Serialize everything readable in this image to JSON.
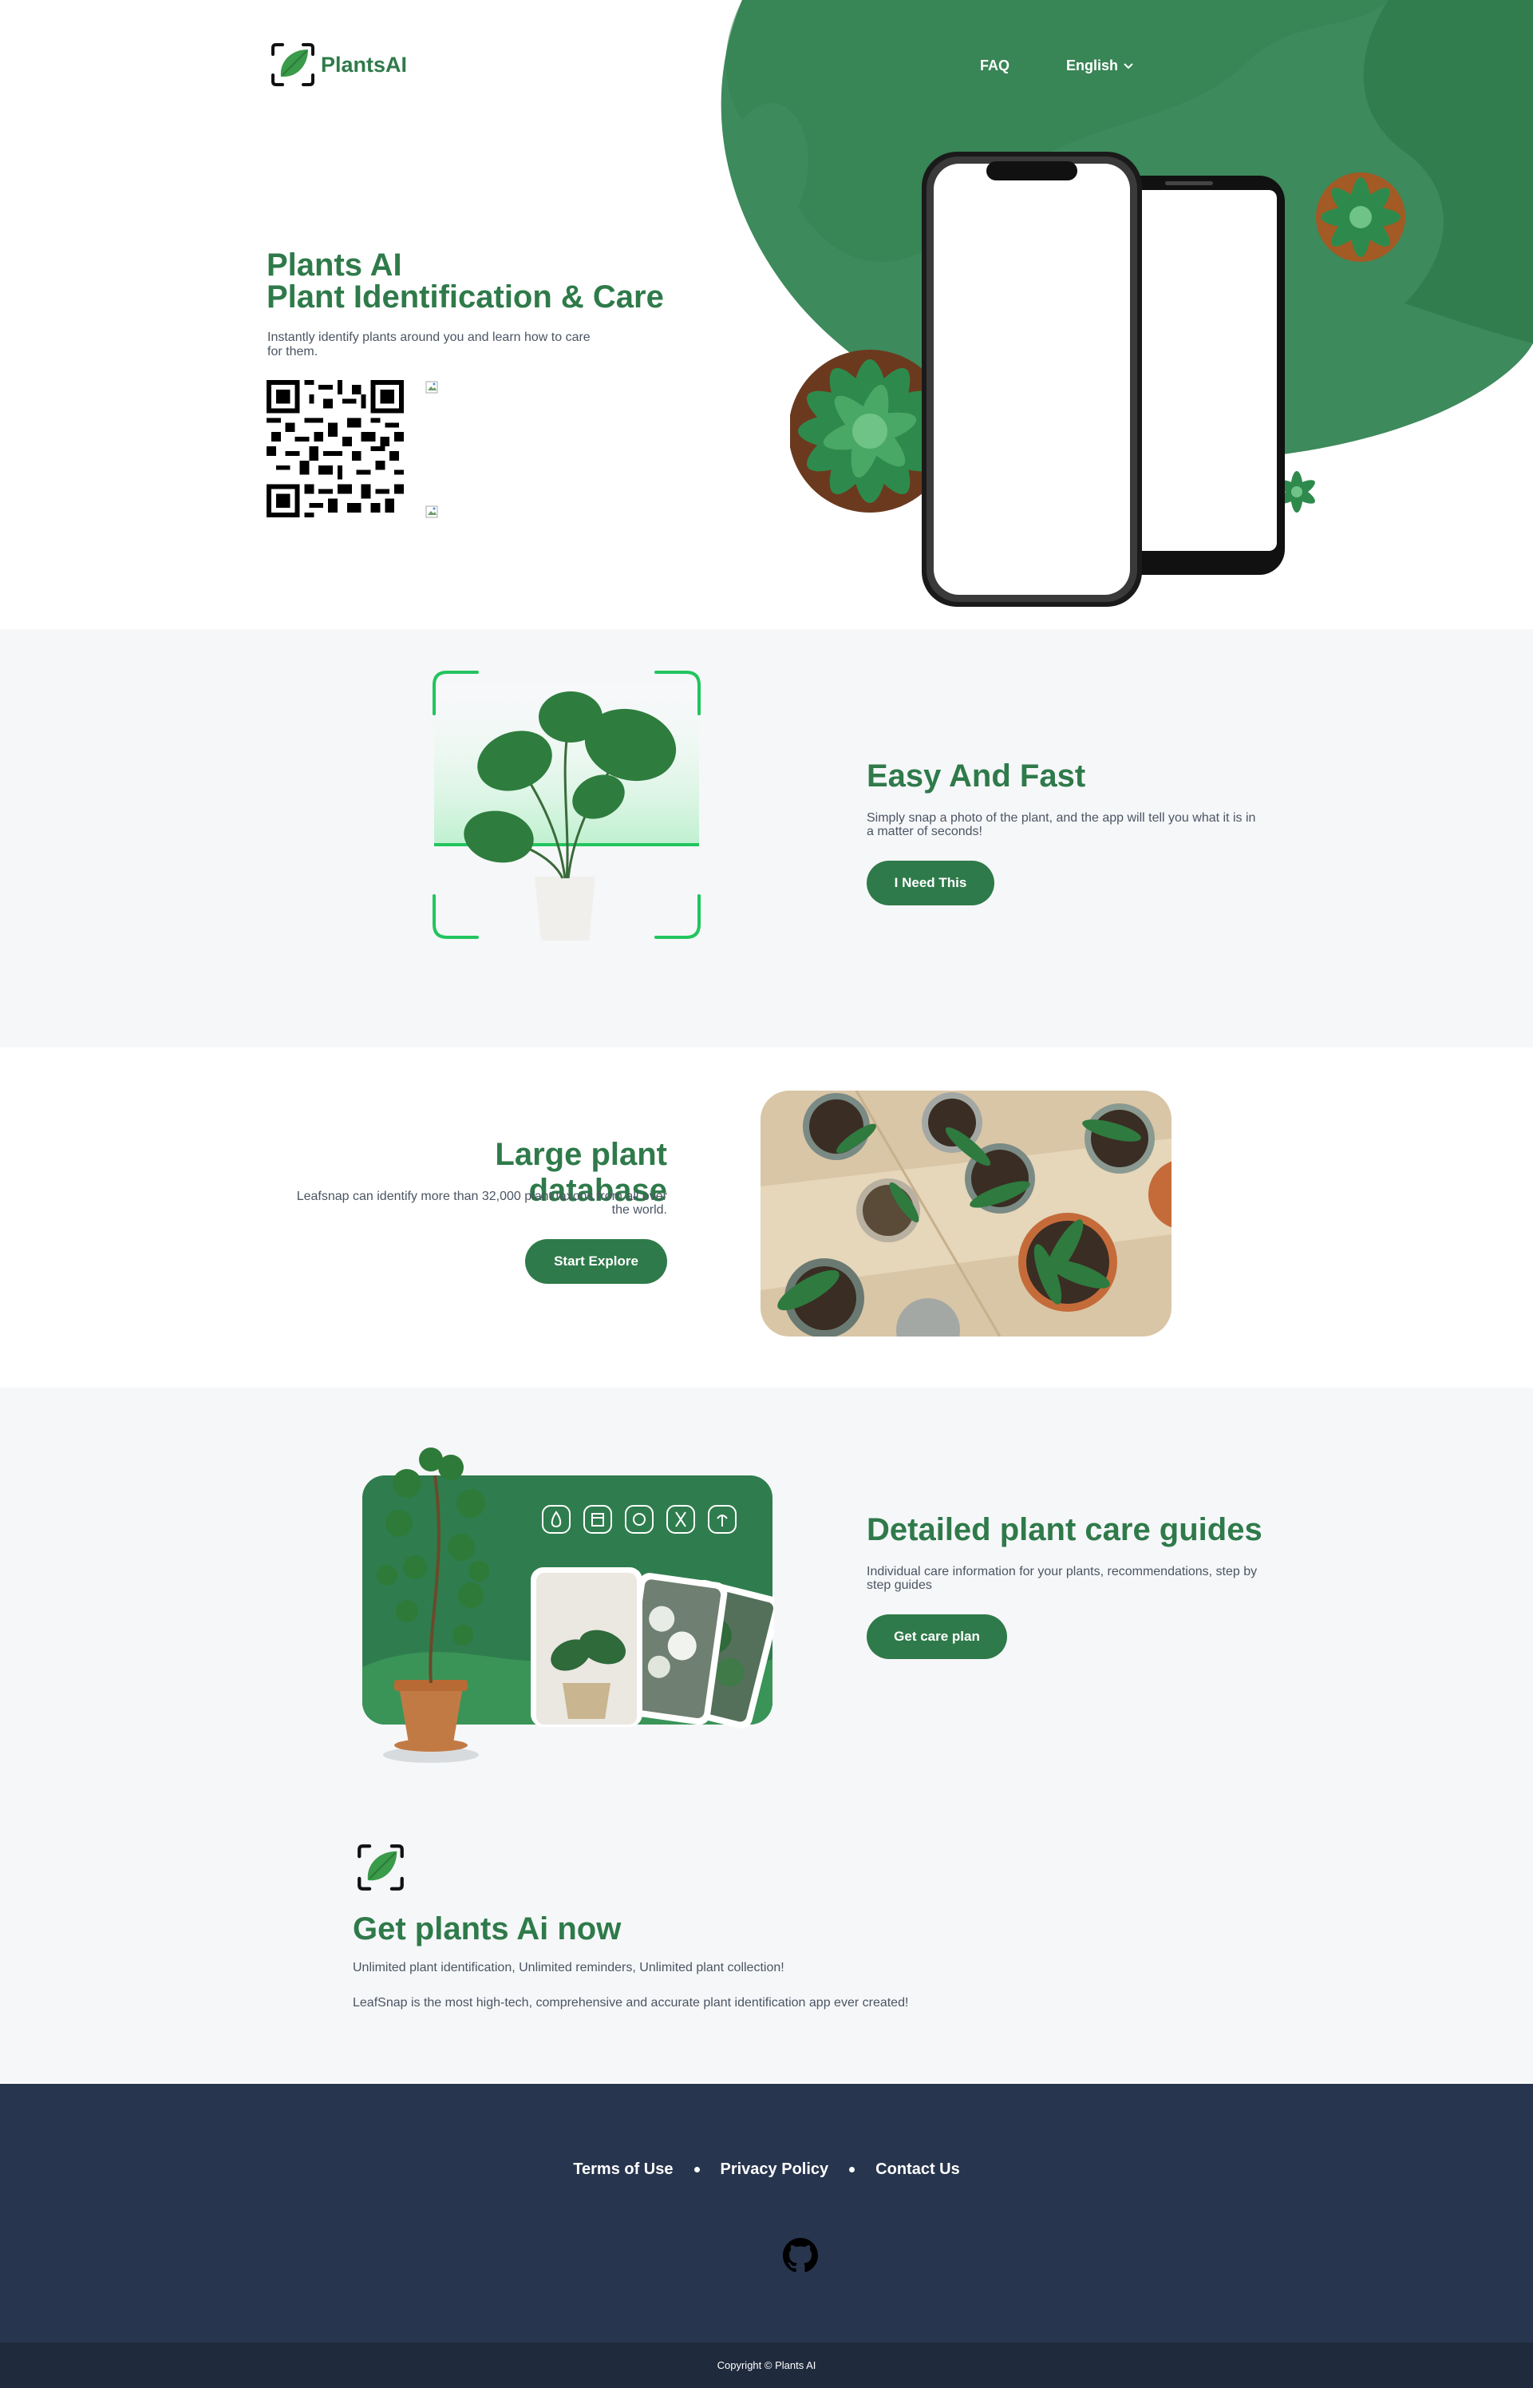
{
  "header": {
    "brand": "PlantsAI",
    "nav": {
      "faq": "FAQ",
      "language": "English"
    }
  },
  "hero": {
    "title_line1": "Plants AI",
    "title_line2": "Plant Identification & Care",
    "subtitle": "Instantly identify plants around you and learn how to care for them."
  },
  "easy": {
    "title": "Easy And Fast",
    "text": "Simply snap a photo of the plant, and the app will tell you what it is in a matter of seconds!",
    "button": "I Need This"
  },
  "database": {
    "title": "Large plant database",
    "text": "Leafsnap can identify more than 32,000 plant taxons from all over the world.",
    "button": "Start Explore"
  },
  "care": {
    "title": "Detailed plant care guides",
    "text": "Individual care information for your plants, recommendations, step by step guides",
    "button": "Get care plan",
    "icons": [
      "water-drop-icon",
      "calendar-icon",
      "sun-icon",
      "scissors-icon",
      "plant-icon"
    ]
  },
  "getnow": {
    "title": "Get plants Ai now",
    "line1": "Unlimited plant identification, Unlimited reminders, Unlimited plant collection!",
    "line2": "LeafSnap is the most high-tech, comprehensive and accurate plant identification app ever created!"
  },
  "footer": {
    "links": [
      "Terms of Use",
      "Privacy Policy",
      "Contact Us"
    ],
    "copyright": "Copyright © Plants AI"
  },
  "colors": {
    "brand_green": "#2f7a4a",
    "hero_green": "#3d8a5c",
    "scan_green": "#22c55e",
    "footer_bg": "#28354e",
    "footer_bottom": "#1f2a3d",
    "section_bg": "#f6f7f9"
  }
}
